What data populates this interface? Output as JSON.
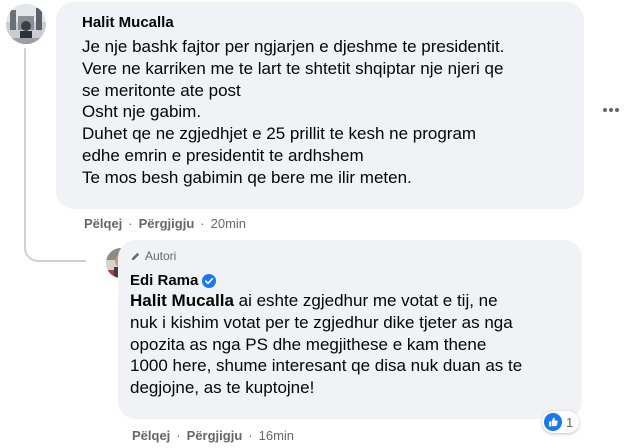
{
  "comment1": {
    "author": "Halit Mucalla",
    "lines": [
      "Je nje bashk fajtor per ngjarjen e djeshme te presidentit.",
      "Vere ne karriken me te lart te shtetit shqiptar nje njeri qe",
      "se meritonte ate post",
      "Osht nje gabim.",
      "Duhet qe ne zgjedhjet e 25 prillit te kesh ne program",
      "edhe emrin e presidentit te ardhshem",
      "Te mos besh gabimin qe bere me ilir meten."
    ],
    "actions": {
      "like": "Pëlqej",
      "reply": "Përgjigju",
      "time": "20min"
    },
    "more_icon": "ellipsis-horizontal-icon"
  },
  "reply1": {
    "badge": "Autori",
    "author": "Edi Rama",
    "verified_icon": "verified-badge-icon",
    "mention": "Halit Mucalla",
    "lines": [
      " ai eshte zgjedhur me votat e tij, ne",
      "nuk i kishim votat per te zgjedhur dike tjeter as nga",
      "opozita as nga PS dhe megjithese e kam thene",
      "1000 here, shume interesant qe disa nuk duan as te",
      "degjojne, as te kuptojne!"
    ],
    "actions": {
      "like": "Pëlqej",
      "reply": "Përgjigju",
      "time": "16min"
    },
    "reaction_count": "1",
    "reaction_icon": "like-reaction-icon",
    "colors": {
      "accent": "#1877f2",
      "verified": "#1877f2"
    }
  }
}
